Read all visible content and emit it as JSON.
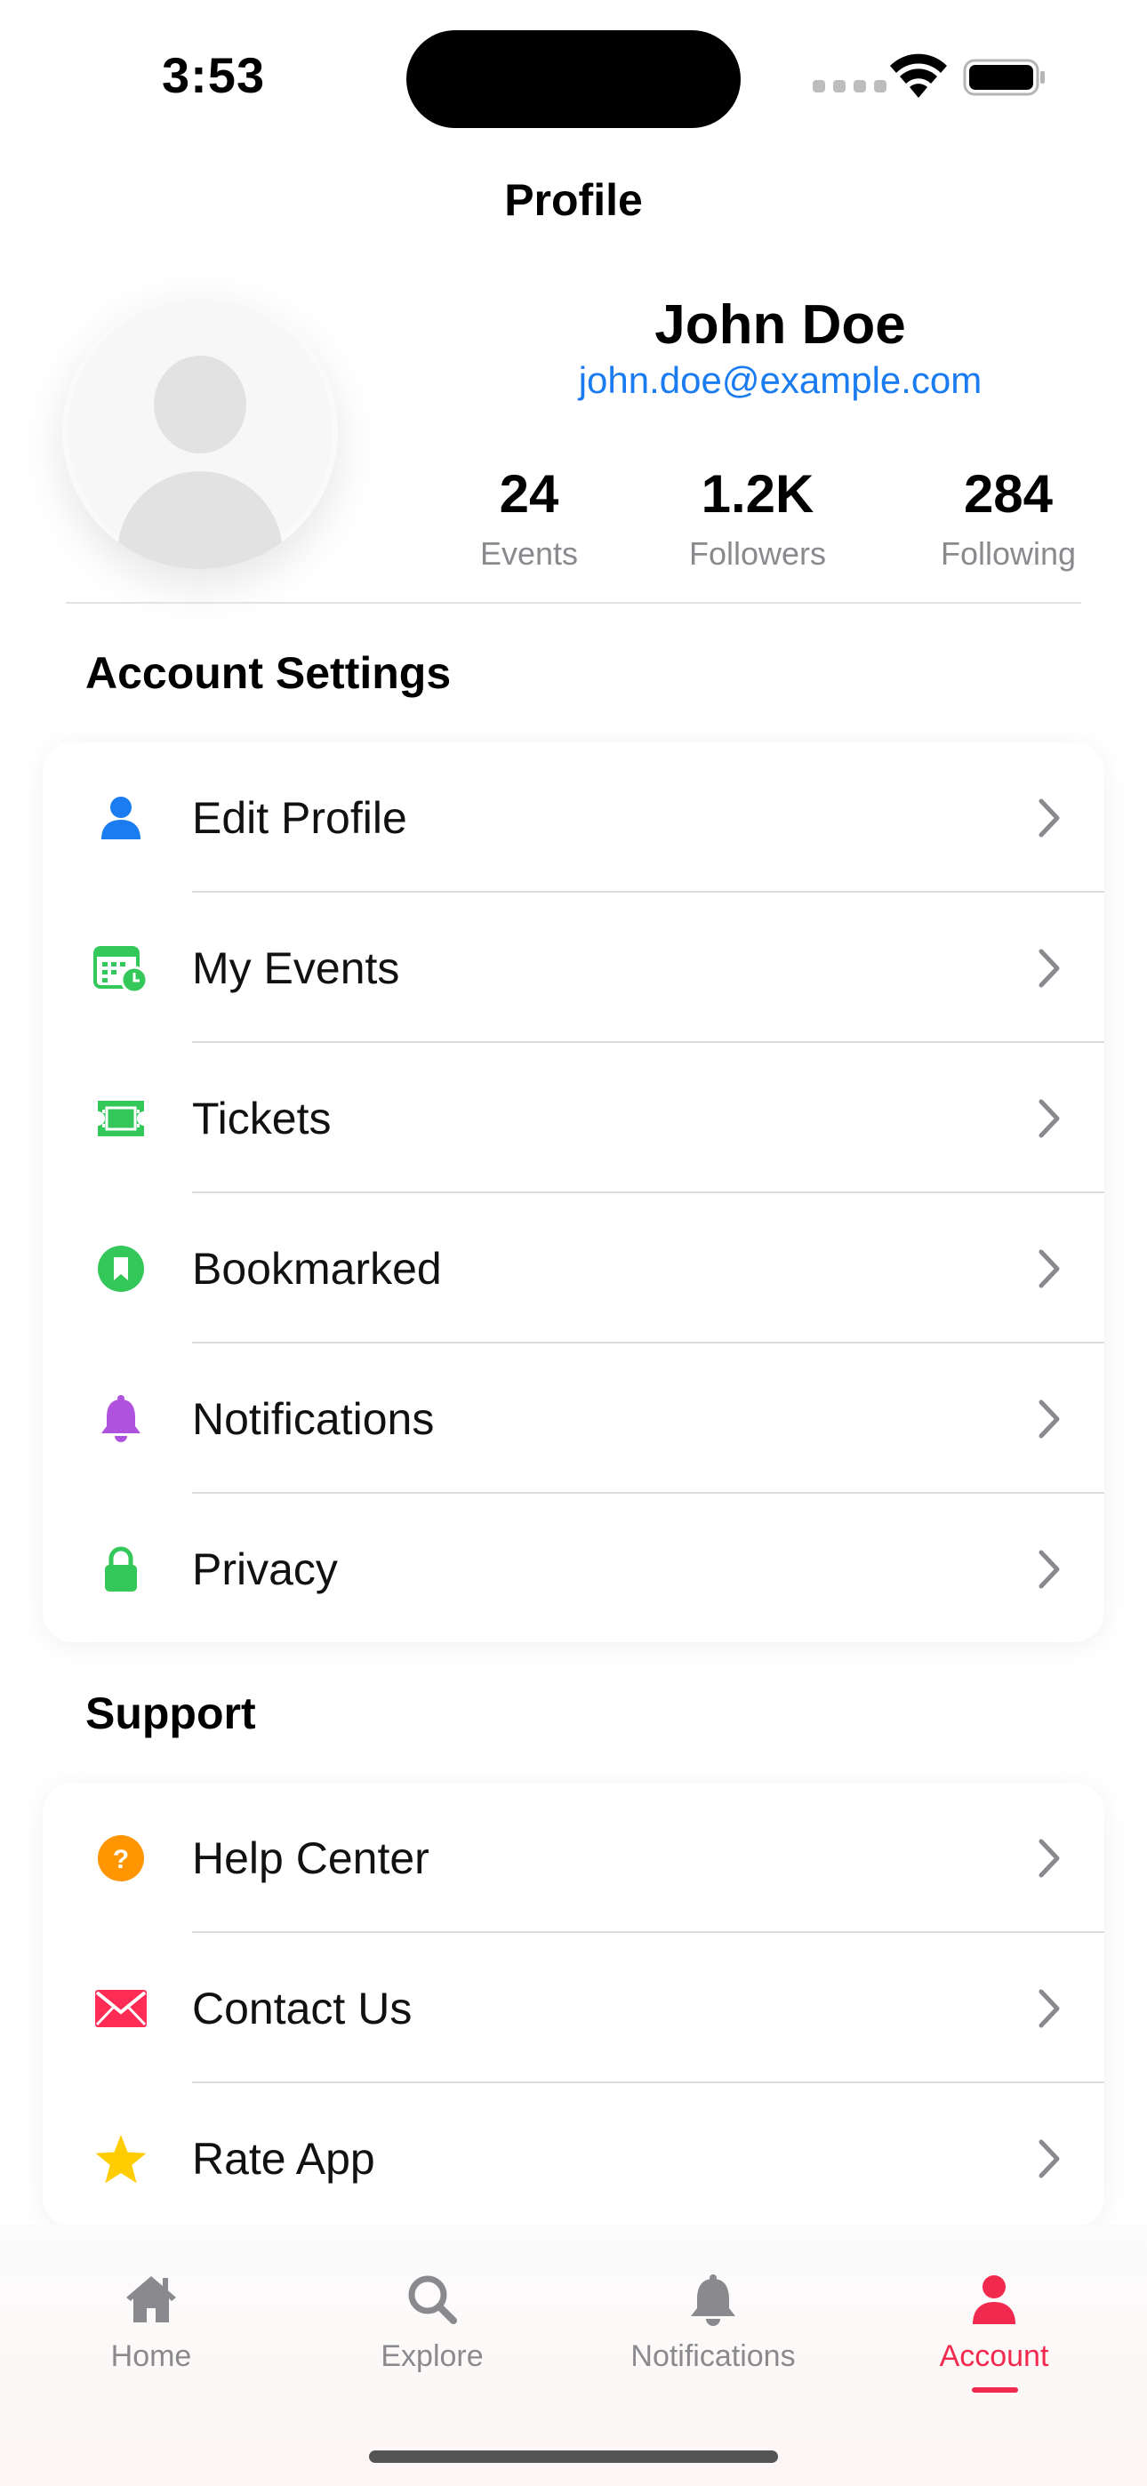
{
  "status_bar": {
    "time": "3:53"
  },
  "nav": {
    "title": "Profile"
  },
  "profile": {
    "name": "John Doe",
    "email": "john.doe@example.com",
    "stats": [
      {
        "value": "24",
        "label": "Events"
      },
      {
        "value": "1.2K",
        "label": "Followers"
      },
      {
        "value": "284",
        "label": "Following"
      }
    ]
  },
  "account_settings": {
    "title": "Account Settings",
    "items": [
      {
        "label": "Edit Profile",
        "icon": "person-icon",
        "color": "#1a7cf0"
      },
      {
        "label": "My Events",
        "icon": "calendar-clock-icon",
        "color": "#34c759"
      },
      {
        "label": "Tickets",
        "icon": "ticket-icon",
        "color": "#34c759"
      },
      {
        "label": "Bookmarked",
        "icon": "bookmark-icon",
        "color": "#34c759"
      },
      {
        "label": "Notifications",
        "icon": "bell-icon",
        "color": "#af52de"
      },
      {
        "label": "Privacy",
        "icon": "lock-icon",
        "color": "#34c759"
      }
    ]
  },
  "support": {
    "title": "Support",
    "items": [
      {
        "label": "Help Center",
        "icon": "question-icon",
        "color": "#ff9500"
      },
      {
        "label": "Contact Us",
        "icon": "envelope-icon",
        "color": "#ff2d55"
      },
      {
        "label": "Rate App",
        "icon": "star-icon",
        "color": "#ffcc00"
      }
    ]
  },
  "tab_bar": {
    "tabs": [
      {
        "label": "Home",
        "icon": "house-icon"
      },
      {
        "label": "Explore",
        "icon": "search-icon"
      },
      {
        "label": "Notifications",
        "icon": "bell-icon"
      },
      {
        "label": "Account",
        "icon": "person-icon"
      }
    ],
    "active": "Account",
    "active_color": "#f2294e",
    "inactive_color": "#8a8a8e"
  }
}
